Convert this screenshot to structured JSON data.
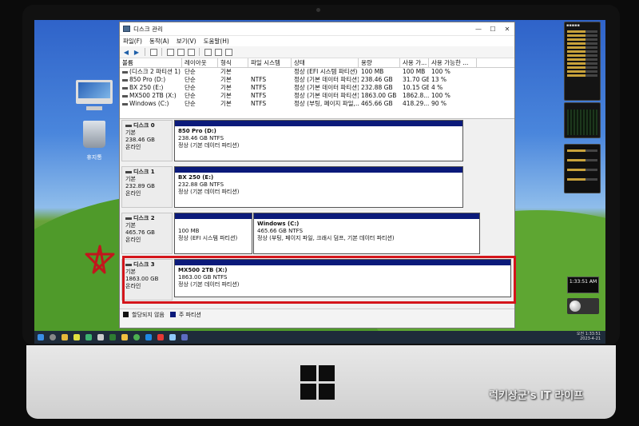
{
  "window": {
    "title": "디스크 관리",
    "controls": {
      "minimize": "—",
      "maximize": "☐",
      "close": "✕"
    }
  },
  "menu": [
    "파일(F)",
    "동작(A)",
    "보기(V)",
    "도움말(H)"
  ],
  "volume_table": {
    "headers": [
      "볼륨",
      "레이아웃",
      "형식",
      "파일 시스템",
      "상태",
      "용량",
      "사용 가...",
      "사용 가능한 ..."
    ],
    "rows": [
      [
        "(디스크 2 파티션 1)",
        "단순",
        "기본",
        "",
        "정상 (EFI 시스템 파티션)",
        "100 MB",
        "100 MB",
        "100 %"
      ],
      [
        "850 Pro (D:)",
        "단순",
        "기본",
        "NTFS",
        "정상 (기본 데이터 파티션)",
        "238.46 GB",
        "31.70 GB",
        "13 %"
      ],
      [
        "BX 250 (E:)",
        "단순",
        "기본",
        "NTFS",
        "정상 (기본 데이터 파티션)",
        "232.88 GB",
        "10.15 GB",
        "4 %"
      ],
      [
        "MX500 2TB (X:)",
        "단순",
        "기본",
        "NTFS",
        "정상 (기본 데이터 파티션)",
        "1863.00 GB",
        "1862.8...",
        "100 %"
      ],
      [
        "Windows (C:)",
        "단순",
        "기본",
        "NTFS",
        "정상 (부팅, 페이지 파일,...",
        "465.66 GB",
        "418.29...",
        "90 %"
      ]
    ]
  },
  "disks": [
    {
      "name": "디스크 0",
      "type": "기본",
      "size": "238.46 GB",
      "status": "온라인",
      "partitions": [
        {
          "name": "850 Pro  (D:)",
          "size": "238.46 GB NTFS",
          "status": "정상 (기본 데이터 파티션)"
        }
      ]
    },
    {
      "name": "디스크 1",
      "type": "기본",
      "size": "232.89 GB",
      "status": "온라인",
      "partitions": [
        {
          "name": "BX 250  (E:)",
          "size": "232.88 GB NTFS",
          "status": "정상 (기본 데이터 파티션)"
        }
      ]
    },
    {
      "name": "디스크 2",
      "type": "기본",
      "size": "465.76 GB",
      "status": "온라인",
      "partitions": [
        {
          "name": "",
          "size": "100 MB",
          "status": "정상 (EFI 시스템 파티션)"
        },
        {
          "name": "Windows  (C:)",
          "size": "465.66 GB NTFS",
          "status": "정상 (부팅, 페이지 파일, 크래시 덤프, 기본 데이터 파티션)"
        }
      ]
    },
    {
      "name": "디스크 3",
      "type": "기본",
      "size": "1863.00 GB",
      "status": "온라인",
      "partitions": [
        {
          "name": "MX500 2TB  (X:)",
          "size": "1863.00 GB NTFS",
          "status": "정상 (기본 데이터 파티션)"
        }
      ]
    }
  ],
  "legend": {
    "unallocated": "할당되지 않음",
    "primary": "주 파티션"
  },
  "desktop": {
    "trash_label": "휴지통"
  },
  "clock_widget": {
    "time": "1:33:51 AM"
  },
  "tray": {
    "time": "오전 1:33:51",
    "date": "2023-4-21"
  },
  "watermark": "럭키상군's IT 라이프",
  "colors": {
    "partition_bar": "#0b1a7a",
    "highlight": "#d4151b",
    "taskbar": "#1e2b3a"
  }
}
